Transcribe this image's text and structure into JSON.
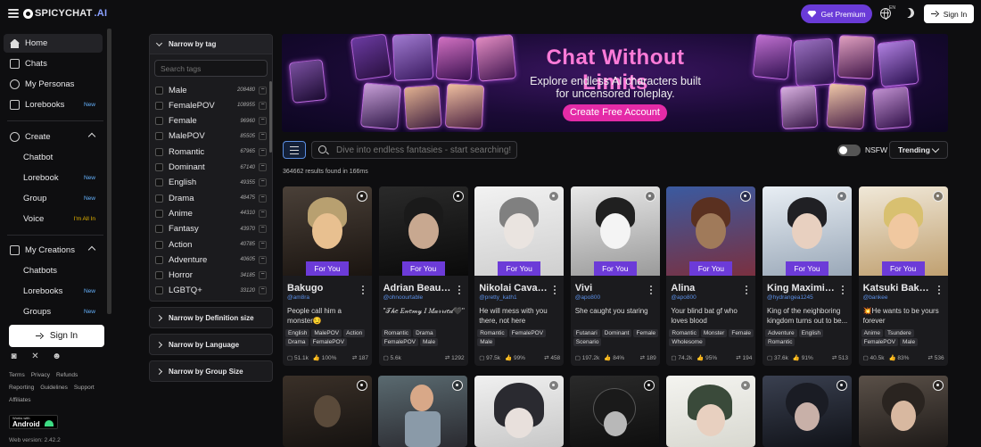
{
  "brand": {
    "spicy": "SPICYCHAT",
    "ai": ".AI"
  },
  "topbar": {
    "premium_label": "Get Premium",
    "lang_code": "EN",
    "sign_in_label": "Sign In"
  },
  "sidebar": {
    "main_items": [
      {
        "label": "Home",
        "icon": "home-icon"
      },
      {
        "label": "Chats",
        "icon": "chat-icon"
      },
      {
        "label": "My Personas",
        "icon": "persona-icon"
      },
      {
        "label": "Lorebooks",
        "icon": "book-icon",
        "badge": "New"
      }
    ],
    "create": {
      "label": "Create",
      "items": [
        {
          "label": "Chatbot"
        },
        {
          "label": "Lorebook",
          "badge": "New"
        },
        {
          "label": "Group",
          "badge": "New"
        },
        {
          "label": "Voice",
          "badge": "I'm All In"
        }
      ]
    },
    "my_creations": {
      "label": "My Creations",
      "items": [
        {
          "label": "Chatbots"
        },
        {
          "label": "Lorebooks",
          "badge": "New"
        },
        {
          "label": "Groups",
          "badge": "New"
        }
      ]
    },
    "sign_in_label": "Sign In",
    "footer_links_1": [
      "Terms",
      "Privacy",
      "Refunds"
    ],
    "footer_links_2": [
      "Reporting",
      "Guidelines",
      "Support"
    ],
    "footer_links_3": [
      "Affiliates"
    ],
    "gplay_small": "Works with",
    "gplay_big": "Android",
    "version": "Web version: 2.42.2"
  },
  "filters": {
    "tag_header": "Narrow by tag",
    "tag_search_placeholder": "Search tags",
    "tags": [
      {
        "name": "Male",
        "count": "208480"
      },
      {
        "name": "FemalePOV",
        "count": "108955"
      },
      {
        "name": "Female",
        "count": "96960"
      },
      {
        "name": "MalePOV",
        "count": "85505"
      },
      {
        "name": "Romantic",
        "count": "67965"
      },
      {
        "name": "Dominant",
        "count": "67140"
      },
      {
        "name": "English",
        "count": "49355"
      },
      {
        "name": "Drama",
        "count": "48475"
      },
      {
        "name": "Anime",
        "count": "44310"
      },
      {
        "name": "Fantasy",
        "count": "43970"
      },
      {
        "name": "Action",
        "count": "40785"
      },
      {
        "name": "Adventure",
        "count": "40605"
      },
      {
        "name": "Horror",
        "count": "34185"
      },
      {
        "name": "LGBTQ+",
        "count": "33120"
      }
    ],
    "definition_size": "Narrow by Definition size",
    "language": "Narrow by Language",
    "group_size": "Narrow by Group Size"
  },
  "banner": {
    "title": "Chat Without Limits",
    "subtitle": "Explore endless AI characters built for uncensored roleplay.",
    "cta": "Create Free Account"
  },
  "search": {
    "placeholder": "Dive into endless fantasies - start searching!",
    "nsfw_label": "NSFW",
    "sort_label": "Trending",
    "results_text": "364662 results found in 166ms"
  },
  "cards": [
    {
      "name": "Bakugo",
      "handle": "@am8ra",
      "desc": "People call him a monster😏",
      "tags": [
        "English",
        "MalePOV",
        "Action",
        "Drama",
        "FemalePOV"
      ],
      "chats": "51.1k",
      "likes": "100%",
      "tokens": "187",
      "for_you": "For You"
    },
    {
      "name": "Adrian Beaumont",
      "handle": "@ohnoourtable",
      "desc": "\"𝒯𝒽𝑒 𝐸𝓃𝑒𝓂𝓎 𝐼 𝑀𝒶𝓇𝓇𝒾𝑒𝒹🖤\"",
      "tags": [
        "Romantic",
        "Drama",
        "FemalePOV",
        "Male"
      ],
      "chats": "5.6k",
      "likes": "",
      "tokens": "1292",
      "for_you": "For You"
    },
    {
      "name": "Nikolai Cavalier",
      "handle": "@pretty_kath1",
      "desc": "He will mess with you there, not here",
      "tags": [
        "Romantic",
        "FemalePOV",
        "Male"
      ],
      "chats": "97.5k",
      "likes": "99%",
      "tokens": "458",
      "for_you": "For You"
    },
    {
      "name": "Vivi",
      "handle": "@apo800",
      "desc": "She caught you staring",
      "tags": [
        "Futanari",
        "Dominant",
        "Female",
        "Scenario"
      ],
      "chats": "197.2k",
      "likes": "84%",
      "tokens": "189",
      "for_you": "For You"
    },
    {
      "name": "Alina",
      "handle": "@apo800",
      "desc": "Your blind bat gf who loves blood",
      "tags": [
        "Romantic",
        "Monster",
        "Female",
        "Wholesome"
      ],
      "chats": "74.2k",
      "likes": "95%",
      "tokens": "194",
      "for_you": "For You"
    },
    {
      "name": "King Maximilian",
      "handle": "@hydrangea1245",
      "desc": "King of the neighboring kingdom turns out to be...",
      "tags": [
        "Adventure",
        "English",
        "Romantic"
      ],
      "chats": "37.6k",
      "likes": "91%",
      "tokens": "513",
      "for_you": "For You"
    },
    {
      "name": "Katsuki Bakugo",
      "handle": "@bankee",
      "desc": "💥He wants to be yours forever",
      "tags": [
        "Anime",
        "Tsundere",
        "FemalePOV",
        "Male"
      ],
      "chats": "40.5k",
      "likes": "83%",
      "tokens": "536",
      "for_you": "For You"
    }
  ],
  "colors": {
    "accent": "#6c3bd8",
    "pink": "#e42ba7",
    "handle": "#5b8fe6"
  }
}
